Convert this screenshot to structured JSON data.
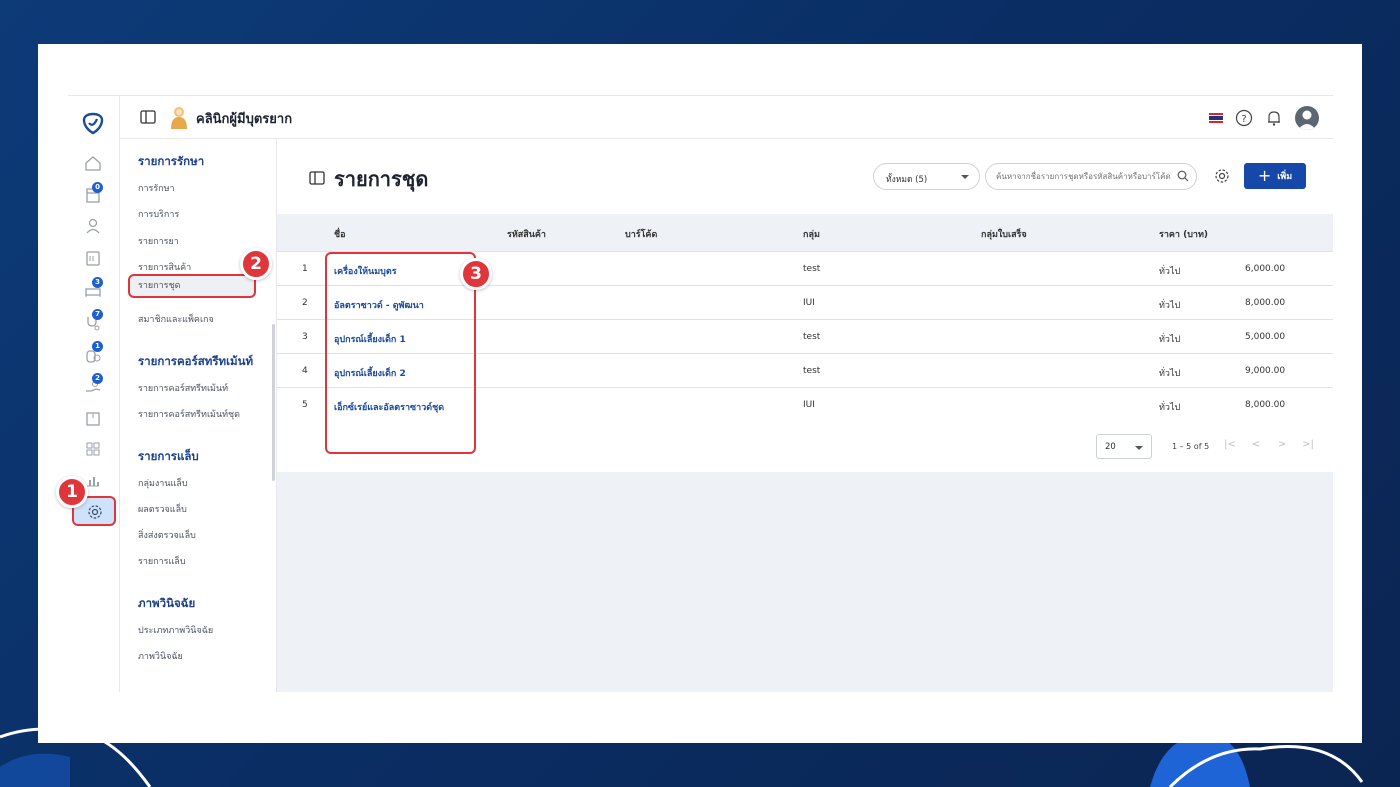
{
  "header": {
    "clinic_name": "คลินิกผู้มีบุตรยาก"
  },
  "rail": {
    "badges": [
      "0",
      "3",
      "7",
      "1",
      "2"
    ]
  },
  "submenu": {
    "sections": [
      {
        "title": "รายการรักษา",
        "items": [
          "การรักษา",
          "การบริการ",
          "รายการยา",
          "รายการสินค้า",
          "รายการชุด",
          "สมาชิกและแพ็คเกจ"
        ]
      },
      {
        "title": "รายการคอร์สทรีทเม้นท์",
        "items": [
          "รายการคอร์สทรีทเม้นท์",
          "รายการคอร์สทรีทเม้นท์ชุด"
        ]
      },
      {
        "title": "รายการแล็บ",
        "items": [
          "กลุ่มงานแล็บ",
          "ผลตรวจแล็บ",
          "สิ่งส่งตรวจแล็บ",
          "รายการแล็บ"
        ]
      },
      {
        "title": "ภาพวินิจฉัย",
        "items": [
          "ประเภทภาพวินิจฉัย",
          "ภาพวินิจฉัย"
        ]
      }
    ]
  },
  "page": {
    "title": "รายการชุด",
    "filter_label": "ทั้งหมด (5)",
    "search_placeholder": "ค้นหาจากชื่อรายการชุดหรือรหัสสินค้าหรือบาร์โค้ด",
    "add_label": "เพิ่ม"
  },
  "table": {
    "columns": [
      "ชื่อ",
      "รหัสสินค้า",
      "บาร์โค้ด",
      "กลุ่ม",
      "กลุ่มใบเสร็จ",
      "ราคา (บาท)"
    ],
    "rows": [
      {
        "no": "1",
        "name": "เครื่องให้นมบุตร",
        "group": "test",
        "price_type": "ทั่วไป",
        "price": "6,000.00"
      },
      {
        "no": "2",
        "name": "อัลตราซาวด์ - ดูพัฒนา",
        "group": "IUI",
        "price_type": "ทั่วไป",
        "price": "8,000.00"
      },
      {
        "no": "3",
        "name": "อุปกรณ์เลี้ยงเด็ก 1",
        "group": "test",
        "price_type": "ทั่วไป",
        "price": "5,000.00"
      },
      {
        "no": "4",
        "name": "อุปกรณ์เลี้ยงเด็ก 2",
        "group": "test",
        "price_type": "ทั่วไป",
        "price": "9,000.00"
      },
      {
        "no": "5",
        "name": "เอ็กซ์เรย์และอัลตราซาวด์ชุด",
        "group": "IUI",
        "price_type": "ทั่วไป",
        "price": "8,000.00"
      }
    ]
  },
  "pagination": {
    "page_size": "20",
    "range": "1 – 5 of 5"
  },
  "markers": [
    "1",
    "2",
    "3"
  ],
  "colors": {
    "accent": "#1548a8",
    "highlight": "#e0353b",
    "background": "#0d3b78"
  }
}
